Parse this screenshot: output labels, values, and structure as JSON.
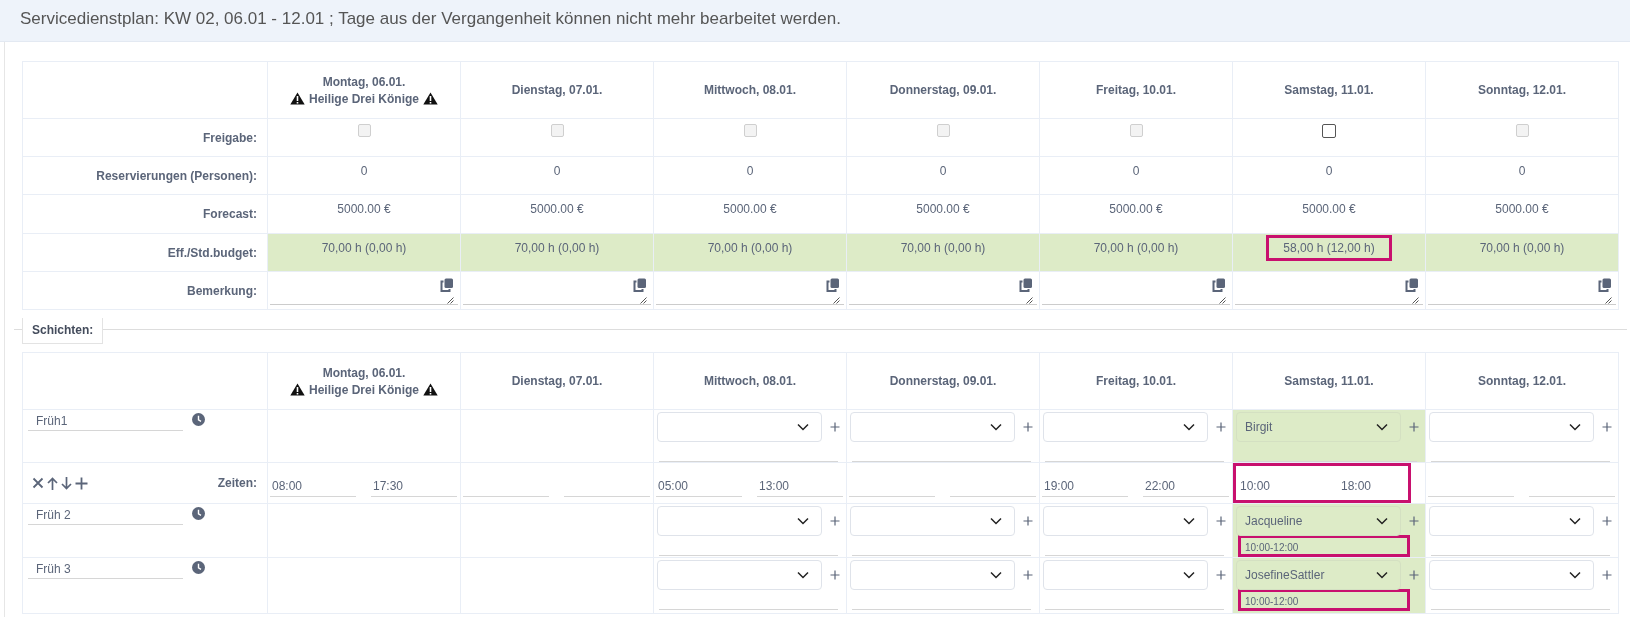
{
  "title": "Servicedienstplan: KW 02, 06.01 - 12.01 ; Tage aus der Vergangenheit können nicht mehr bearbeitet werden.",
  "overview": {
    "row_labels": [
      "Freigabe:",
      "Reservierungen (Personen):",
      "Forecast:",
      "Eff./Std.budget:",
      "Bemerkung:"
    ],
    "days": [
      {
        "name": "Montag, 06.01.",
        "holiday": "Heilige Drei Könige",
        "release": {
          "checked": false,
          "disabled": true
        },
        "reservations": "0",
        "forecast": "5000.00 €",
        "budget": "70,00 h (0,00 h)",
        "budget_highlighted": false
      },
      {
        "name": "Dienstag, 07.01.",
        "release": {
          "checked": false,
          "disabled": true
        },
        "reservations": "0",
        "forecast": "5000.00 €",
        "budget": "70,00 h (0,00 h)",
        "budget_highlighted": false
      },
      {
        "name": "Mittwoch, 08.01.",
        "release": {
          "checked": false,
          "disabled": true
        },
        "reservations": "0",
        "forecast": "5000.00 €",
        "budget": "70,00 h (0,00 h)",
        "budget_highlighted": false
      },
      {
        "name": "Donnerstag, 09.01.",
        "release": {
          "checked": false,
          "disabled": true
        },
        "reservations": "0",
        "forecast": "5000.00 €",
        "budget": "70,00 h (0,00 h)",
        "budget_highlighted": false
      },
      {
        "name": "Freitag, 10.01.",
        "release": {
          "checked": false,
          "disabled": true
        },
        "reservations": "0",
        "forecast": "5000.00 €",
        "budget": "70,00 h (0,00 h)",
        "budget_highlighted": false
      },
      {
        "name": "Samstag, 11.01.",
        "release": {
          "checked": false,
          "disabled": false
        },
        "reservations": "0",
        "forecast": "5000.00 €",
        "budget": "58,00 h (12,00 h)",
        "budget_highlighted": true
      },
      {
        "name": "Sonntag, 12.01.",
        "release": {
          "checked": false,
          "disabled": true
        },
        "reservations": "0",
        "forecast": "5000.00 €",
        "budget": "70,00 h (0,00 h)",
        "budget_highlighted": false
      }
    ]
  },
  "shifts_section": {
    "legend": "Schichten:",
    "times_label": "Zeiten:",
    "days": [
      {
        "name": "Montag, 06.01.",
        "holiday": "Heilige Drei Könige"
      },
      {
        "name": "Dienstag, 07.01."
      },
      {
        "name": "Mittwoch, 08.01."
      },
      {
        "name": "Donnerstag, 09.01."
      },
      {
        "name": "Freitag, 10.01."
      },
      {
        "name": "Samstag, 11.01."
      },
      {
        "name": "Sonntag, 12.01."
      }
    ],
    "shifts": [
      {
        "name": "Früh1",
        "cells": [
          {
            "kind": "none"
          },
          {
            "kind": "none"
          },
          {
            "kind": "select",
            "assigned": false,
            "time_highlighted": false
          },
          {
            "kind": "select",
            "assigned": false,
            "time_highlighted": false
          },
          {
            "kind": "select",
            "assigned": false,
            "time_highlighted": false
          },
          {
            "kind": "select",
            "assigned": true,
            "value": "Birgit",
            "time_highlighted": false
          },
          {
            "kind": "select",
            "assigned": false,
            "time_highlighted": false
          }
        ],
        "times": [
          {
            "start": "08:00",
            "end": "17:30",
            "highlighted": false
          },
          {
            "highlighted": false
          },
          {
            "start": "05:00",
            "end": "13:00",
            "highlighted": false
          },
          {
            "highlighted": false
          },
          {
            "start": "19:00",
            "end": "22:00",
            "highlighted": false
          },
          {
            "start": "10:00",
            "end": "18:00",
            "highlighted": true
          },
          {
            "highlighted": false
          }
        ]
      },
      {
        "name": "Früh 2",
        "cells": [
          {
            "kind": "none"
          },
          {
            "kind": "none"
          },
          {
            "kind": "select",
            "assigned": false,
            "time_highlighted": false
          },
          {
            "kind": "select",
            "assigned": false,
            "time_highlighted": false
          },
          {
            "kind": "select",
            "assigned": false,
            "time_highlighted": false
          },
          {
            "kind": "select",
            "assigned": true,
            "value": "Jacqueline",
            "time": "10:00-12:00",
            "time_highlighted": true
          },
          {
            "kind": "select",
            "assigned": false,
            "time_highlighted": false
          }
        ]
      },
      {
        "name": "Früh 3",
        "cells": [
          {
            "kind": "none"
          },
          {
            "kind": "none"
          },
          {
            "kind": "select",
            "assigned": false,
            "time_highlighted": false
          },
          {
            "kind": "select",
            "assigned": false,
            "time_highlighted": false
          },
          {
            "kind": "select",
            "assigned": false,
            "time_highlighted": false
          },
          {
            "kind": "select",
            "assigned": true,
            "value": "JosefineSattler",
            "time": "10:00-12:00",
            "time_highlighted": true
          },
          {
            "kind": "select",
            "assigned": false,
            "time_highlighted": false
          }
        ]
      }
    ]
  }
}
